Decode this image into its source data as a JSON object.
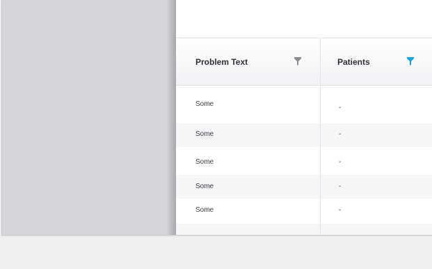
{
  "grid": {
    "columns": [
      {
        "label": "Problem Text",
        "filter_icon": "filter-icon",
        "filter_color": "#8c8c90",
        "filter_active": false
      },
      {
        "label": "Patients",
        "filter_icon": "filter-icon",
        "filter_color": "#1aa3e0",
        "filter_active": true
      }
    ],
    "rows": [
      {
        "problem_text": "Some",
        "patients": "-"
      },
      {
        "problem_text": "Some",
        "patients": "-"
      },
      {
        "problem_text": "Some",
        "patients": "-"
      },
      {
        "problem_text": "Some",
        "patients": "-"
      },
      {
        "problem_text": "Some",
        "patients": "-"
      }
    ]
  },
  "colors": {
    "left_panel": "#d5d6d9",
    "row_alt": "#f6f6f9",
    "page_background": "#f0f0f0"
  }
}
